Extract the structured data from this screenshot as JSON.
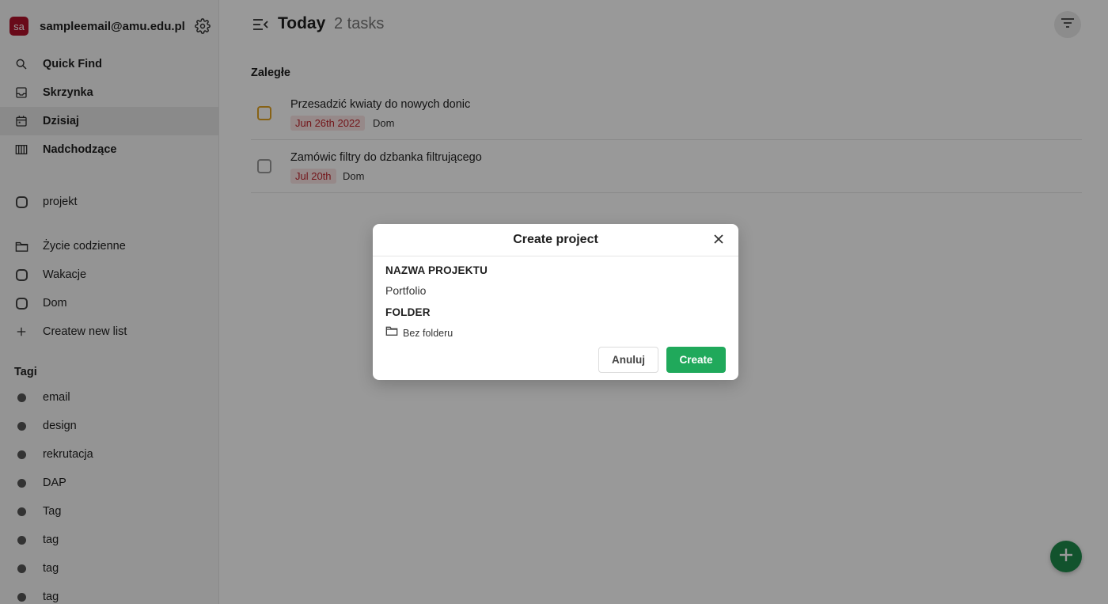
{
  "account": {
    "initials": "sa",
    "email": "sampleemail@amu.edu.pl"
  },
  "nav": [
    {
      "label": "Quick Find",
      "icon": "search-icon"
    },
    {
      "label": "Skrzynka",
      "icon": "inbox-icon"
    },
    {
      "label": "Dzisiaj",
      "icon": "calendar-icon"
    },
    {
      "label": "Nadchodzące",
      "icon": "columns-icon"
    }
  ],
  "projects": [
    {
      "label": "projekt",
      "icon": "list-outline-icon"
    }
  ],
  "lists": [
    {
      "label": "Życie codzienne",
      "icon": "folder-icon"
    },
    {
      "label": "Wakacje",
      "icon": "list-outline-icon"
    },
    {
      "label": "Dom",
      "icon": "list-outline-icon"
    },
    {
      "label": "Createw new list",
      "icon": "plus-icon"
    }
  ],
  "tags_title": "Tagi",
  "tags": [
    "email",
    "design",
    "rekrutacja",
    "DAP",
    "Tag",
    "tag",
    "tag",
    "tag"
  ],
  "main": {
    "title": "Today",
    "count": "2 tasks",
    "group_title": "Zaległe",
    "tasks": [
      {
        "name": "Przesadzić kwiaty do nowych donic",
        "date": "Jun 26th 2022",
        "project": "Dom",
        "priority_color": "#e2a323"
      },
      {
        "name": "Zamówic filtry do dzbanka filtrującego",
        "date": "Jul 20th",
        "project": "Dom",
        "priority_color": "#9a9a9a"
      }
    ]
  },
  "modal": {
    "title": "Create project",
    "name_label": "NAZWA PROJEKTU",
    "name_value": "Portfolio",
    "folder_label": "FOLDER",
    "folder_value": "Bez folderu",
    "cancel_label": "Anuluj",
    "create_label": "Create"
  },
  "colors": {
    "accent": "#20a95b",
    "fab": "#1f8a4c",
    "avatar": "#b0122a",
    "date_text": "#c0262d"
  }
}
